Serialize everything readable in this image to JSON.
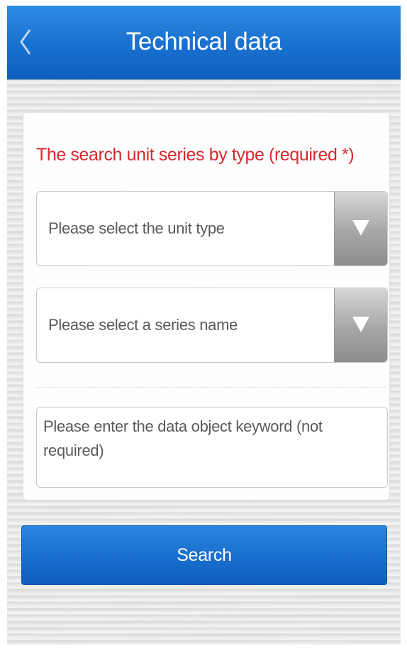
{
  "header": {
    "title": "Technical data",
    "back_icon": "chevron-left-icon"
  },
  "form": {
    "section_title": "The search unit series by type (required *)",
    "unit_type_select": {
      "placeholder": "Please select the unit type",
      "arrow_icon": "triangle-down-icon"
    },
    "series_name_select": {
      "placeholder": "Please select a series name",
      "arrow_icon": "triangle-down-icon"
    },
    "keyword_input": {
      "placeholder": "Please enter the data object keyword (not required)",
      "value": ""
    }
  },
  "search_button": {
    "label": "Search"
  },
  "colors": {
    "header_blue": "#1a72d0",
    "required_red": "#d7292e",
    "button_blue": "#1a70cf"
  }
}
